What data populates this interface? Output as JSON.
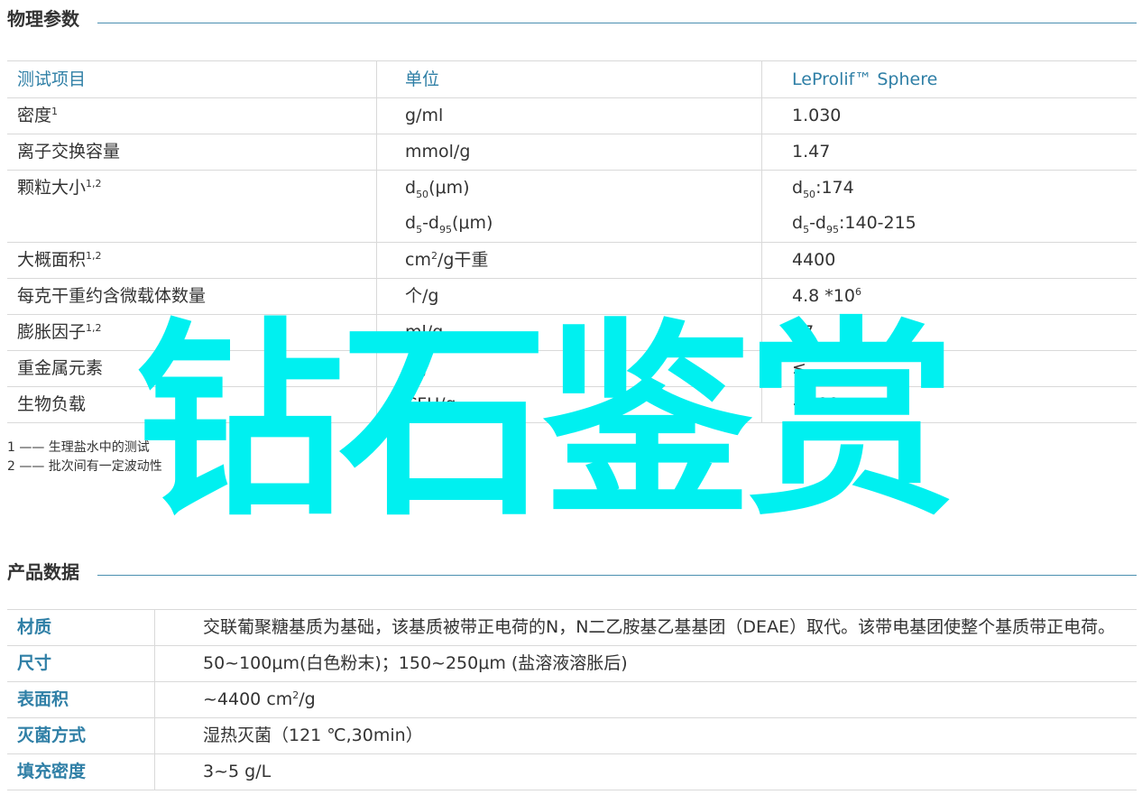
{
  "sections": {
    "physical_title": "物理参数",
    "product_title": "产品数据"
  },
  "physical_table": {
    "headers": [
      "测试项目",
      "单位",
      "LeProlif™ Sphere"
    ],
    "rows": [
      {
        "item": "密度",
        "item_sup": "1",
        "unit": "g/ml",
        "value": "1.030"
      },
      {
        "item": "离子交换容量",
        "unit": "mmol/g",
        "value": "1.47"
      },
      {
        "item": "颗粒大小",
        "item_sup": "1,2",
        "unit_lines": [
          {
            "pre": "d",
            "sub": "50",
            "post": "(μm)"
          },
          {
            "pre": "d",
            "sub": "5",
            "mid": "-d",
            "sub2": "95",
            "post": "(μm)"
          }
        ],
        "value_lines": [
          {
            "pre": "d",
            "sub": "50",
            "post": ":174"
          },
          {
            "pre": "d",
            "sub": "5",
            "mid": "-d",
            "sub2": "95",
            "post": ":140-215"
          }
        ]
      },
      {
        "item": "大概面积",
        "item_sup": "1,2",
        "unit_pre": "cm",
        "unit_sup": "2",
        "unit_post": "/g干重",
        "value": "4400"
      },
      {
        "item": "每克干重约含微载体数量",
        "unit": "个/g",
        "value_pre": "4.8 *10",
        "value_sup": "6"
      },
      {
        "item": "膨胀因子",
        "item_sup": "1,2",
        "unit": "ml/g",
        "value": "17"
      },
      {
        "item": "重金属元素",
        "unit": "μg",
        "value": "≤"
      },
      {
        "item": "生物负载",
        "unit": "CFU/g",
        "value": "<100"
      }
    ]
  },
  "notes": [
    "1 —— 生理盐水中的测试",
    "2 —— 批次间有一定波动性"
  ],
  "product_table": {
    "rows": [
      {
        "key": "材质",
        "value": "交联葡聚糖基质为基础，该基质被带正电荷的N，N二乙胺基乙基基团（DEAE）取代。该带电基团使整个基质带正电荷。"
      },
      {
        "key": "尺寸",
        "value": "50~100μm(白色粉末)；150~250μm (盐溶液溶胀后)"
      },
      {
        "key": "表面积",
        "value_pre": "~4400 cm",
        "value_sup": "2",
        "value_post": "/g"
      },
      {
        "key": "灭菌方式",
        "value": "湿热灭菌（121 ℃,30min）"
      },
      {
        "key": "填充密度",
        "value": "3~5 g/L"
      }
    ]
  },
  "watermark": {
    "text": "钻石鉴赏",
    "color": "#00f0f0"
  },
  "colors": {
    "accent": "#2f7fa6",
    "rule": "#4a8fb0",
    "border": "#d9d9d9"
  }
}
